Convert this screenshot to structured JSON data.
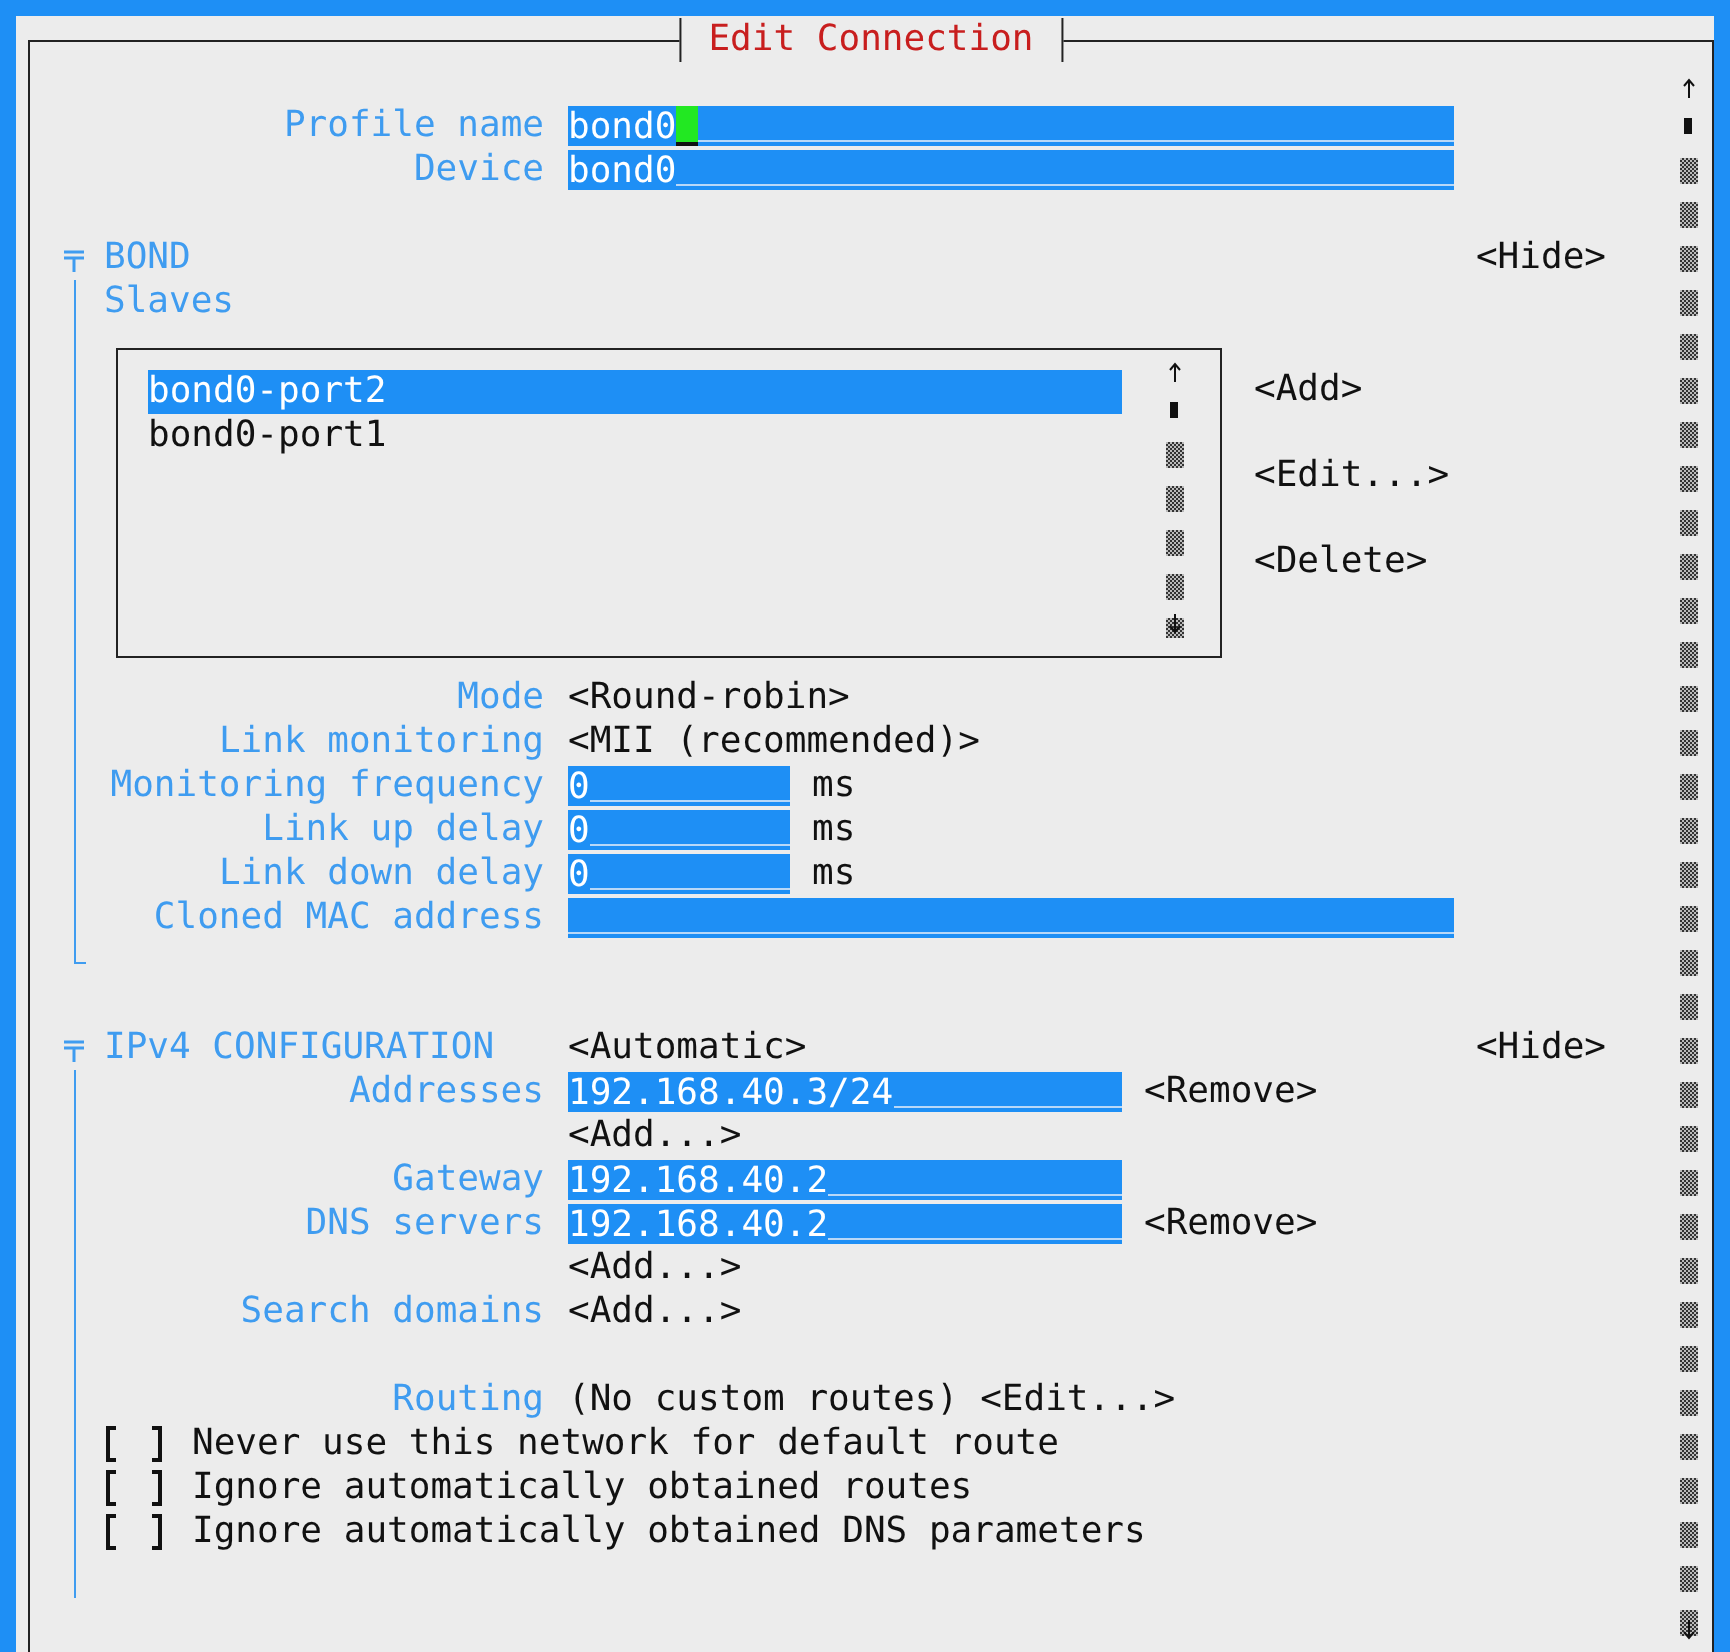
{
  "window": {
    "title": "Edit Connection"
  },
  "profile": [
    {
      "label": "Profile name",
      "value": "bond0",
      "focused": true
    },
    {
      "label": "Device",
      "value": "bond0",
      "focused": false
    }
  ],
  "bond": {
    "title": "BOND",
    "toggle": "<Hide>",
    "slaves": {
      "label": "Slaves",
      "items": [
        {
          "name": "bond0-port2",
          "selected": true
        },
        {
          "name": "bond0-port1",
          "selected": false
        }
      ],
      "buttons": [
        "<Add>",
        "<Edit...>",
        "<Delete>"
      ]
    },
    "fields": [
      {
        "kind": "choice",
        "label": "Mode",
        "value": "<Round-robin>"
      },
      {
        "kind": "choice",
        "label": "Link monitoring",
        "value": "<MII (recommended)>"
      },
      {
        "kind": "short",
        "label": "Monitoring frequency",
        "value": "0",
        "unit": "ms"
      },
      {
        "kind": "short",
        "label": "Link up delay",
        "value": "0",
        "unit": "ms"
      },
      {
        "kind": "short",
        "label": "Link down delay",
        "value": "0",
        "unit": "ms"
      },
      {
        "kind": "long",
        "label": "Cloned MAC address"
      }
    ]
  },
  "ipv4": {
    "title": "IPv4 CONFIGURATION",
    "method": "<Automatic>",
    "toggle": "<Hide>",
    "rows": [
      {
        "kind": "field",
        "label": "Addresses",
        "value": "192.168.40.3/24",
        "action": "<Remove>"
      },
      {
        "kind": "button",
        "value": "<Add...>"
      },
      {
        "kind": "field",
        "label": "Gateway",
        "value": "192.168.40.2"
      },
      {
        "kind": "field",
        "label": "DNS servers",
        "value": "192.168.40.2",
        "action": "<Remove>"
      },
      {
        "kind": "button",
        "value": "<Add...>"
      },
      {
        "kind": "button",
        "label": "Search domains",
        "value": "<Add...>"
      },
      {
        "kind": "blank"
      },
      {
        "kind": "routing",
        "label": "Routing",
        "text": "(No custom routes)",
        "value": "<Edit...>"
      }
    ],
    "checkboxes": [
      {
        "label": "Never use this network for default route",
        "checked": false
      },
      {
        "label": "Ignore automatically obtained routes",
        "checked": false
      },
      {
        "label": "Ignore automatically obtained DNS parameters",
        "checked": false
      }
    ]
  }
}
